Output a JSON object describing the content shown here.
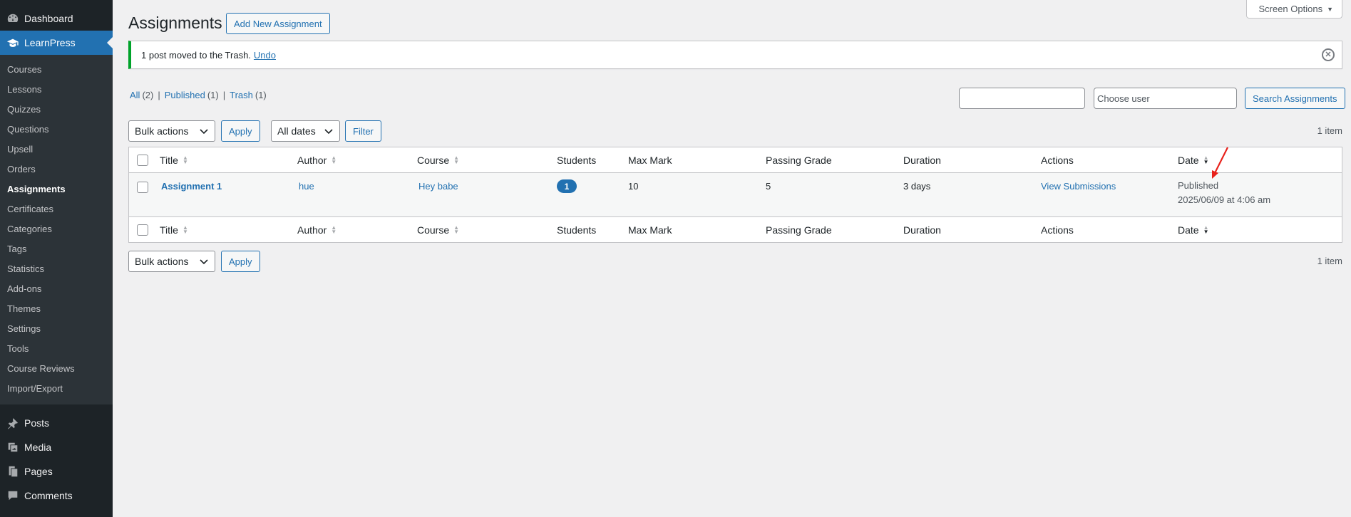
{
  "sidebar": {
    "dashboard": "Dashboard",
    "learnpress": "LearnPress",
    "submenu": [
      {
        "label": "Courses",
        "name": "courses"
      },
      {
        "label": "Lessons",
        "name": "lessons"
      },
      {
        "label": "Quizzes",
        "name": "quizzes"
      },
      {
        "label": "Questions",
        "name": "questions"
      },
      {
        "label": "Upsell",
        "name": "upsell"
      },
      {
        "label": "Orders",
        "name": "orders"
      },
      {
        "label": "Assignments",
        "name": "assignments"
      },
      {
        "label": "Certificates",
        "name": "certificates"
      },
      {
        "label": "Categories",
        "name": "categories"
      },
      {
        "label": "Tags",
        "name": "tags"
      },
      {
        "label": "Statistics",
        "name": "statistics"
      },
      {
        "label": "Add-ons",
        "name": "add-ons"
      },
      {
        "label": "Themes",
        "name": "themes"
      },
      {
        "label": "Settings",
        "name": "settings"
      },
      {
        "label": "Tools",
        "name": "tools"
      },
      {
        "label": "Course Reviews",
        "name": "course-reviews"
      },
      {
        "label": "Import/Export",
        "name": "import-export"
      }
    ],
    "lower": [
      {
        "label": "Posts",
        "icon": "pin-icon"
      },
      {
        "label": "Media",
        "icon": "media-icon"
      },
      {
        "label": "Pages",
        "icon": "pages-icon"
      },
      {
        "label": "Comments",
        "icon": "comments-icon"
      }
    ],
    "accent": "#2271b1"
  },
  "header": {
    "title": "Assignments",
    "add_new": "Add New Assignment",
    "screen_options": "Screen Options"
  },
  "notice": {
    "text": "1 post moved to the Trash.",
    "undo": "Undo"
  },
  "views": {
    "all": "All",
    "all_count": "(2)",
    "published": "Published",
    "published_count": "(1)",
    "trash": "Trash",
    "trash_count": "(1)"
  },
  "search": {
    "value": "",
    "user_placeholder": "Choose user",
    "button": "Search Assignments"
  },
  "tablenav": {
    "bulk_actions": "Bulk actions",
    "apply": "Apply",
    "all_dates": "All dates",
    "filter": "Filter",
    "item_count": "1 item"
  },
  "table": {
    "columns": {
      "title": "Title",
      "author": "Author",
      "course": "Course",
      "students": "Students",
      "max_mark": "Max Mark",
      "passing_grade": "Passing Grade",
      "duration": "Duration",
      "actions": "Actions",
      "date": "Date"
    },
    "rows": [
      {
        "title": "Assignment 1",
        "author": "hue",
        "course": "Hey babe",
        "students": "1",
        "max_mark": "10",
        "passing_grade": "5",
        "duration": "3 days",
        "action": "View Submissions",
        "status": "Published",
        "date": "2025/06/09 at 4:06 am"
      }
    ]
  }
}
